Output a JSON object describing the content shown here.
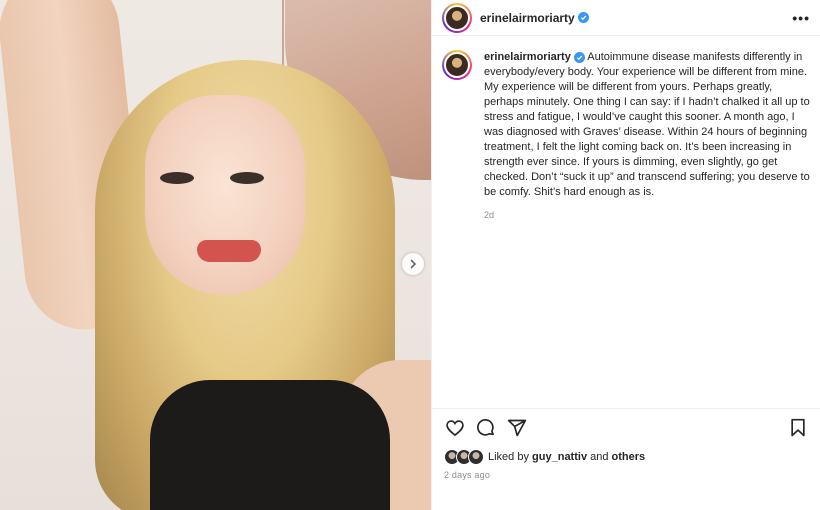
{
  "post": {
    "username": "erinelairmoriarty",
    "caption": "Autoimmune disease manifests differently in everybody/every body. Your experience will be different from mine. My experience will be different from yours. Perhaps greatly, perhaps minutely. One thing I can say: if I hadn’t chalked it all up to stress and fatigue, I would’ve caught this sooner. A month ago, I was diagnosed with Graves’ disease. Within 24 hours of beginning treatment, I felt the light coming back on. It’s been increasing in strength ever since. If yours is dimming, even slightly, go get checked. Don’t “suck it up” and transcend suffering; you deserve to be comfy. Shit’s hard enough as is.",
    "caption_age": "2d",
    "liked_by_prefix": "Liked by",
    "liked_by_user": "guy_nattiv",
    "liked_by_and": "and",
    "liked_by_others": "others",
    "posted_ago": "2 days ago"
  },
  "icons": {
    "more": "more-options-icon",
    "verified": "verified-badge-icon",
    "like": "heart-icon",
    "comment": "comment-icon",
    "share": "share-icon",
    "save": "bookmark-icon",
    "next": "chevron-right-icon"
  },
  "colors": {
    "verified_blue": "#3897f0",
    "muted_text": "#8e8e8e",
    "text": "#262626"
  }
}
